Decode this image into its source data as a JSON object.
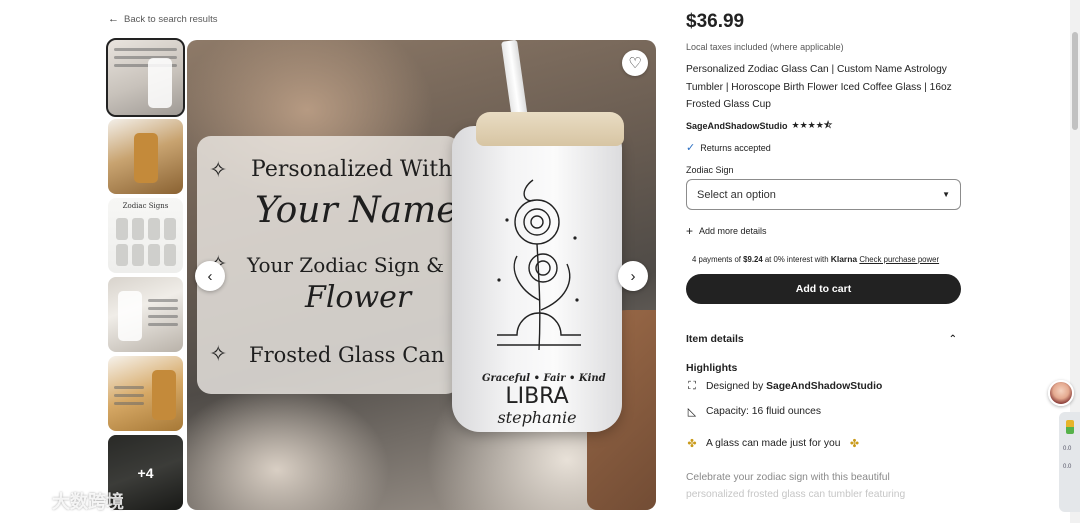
{
  "nav": {
    "back_label": "Back to search results"
  },
  "gallery": {
    "more_count": "+4",
    "thumb3_title": "Zodiac Signs",
    "overlay": {
      "line1": "Personalized With",
      "line2": "Your Name",
      "line3": "Your Zodiac Sign &",
      "line4": "Flower",
      "line5": "Frosted Glass Can"
    },
    "cup": {
      "tagline": "Graceful • Fair • Kind",
      "sign": "LIBRA",
      "name": "stephanie"
    },
    "icons": {
      "favorite": "heart-icon",
      "prev": "chevron-left-icon",
      "next": "chevron-right-icon"
    }
  },
  "product": {
    "price": "$36.99",
    "tax_note": "Local taxes included (where applicable)",
    "title": "Personalized Zodiac Glass Can | Custom Name Astrology Tumbler | Horoscope Birth Flower Iced Coffee Glass | 16oz Frosted Glass Cup",
    "shop_name": "SageAndShadowStudio",
    "rating_stars": "★★★★⯪",
    "returns": "Returns accepted",
    "option_label": "Zodiac Sign",
    "option_placeholder": "Select an option",
    "add_details": "Add more details",
    "klarna": {
      "prefix": "4 payments of ",
      "amount": "$9.24",
      "middle": " at 0% interest with ",
      "brand": "Klarna",
      "link": "Check purchase power"
    },
    "add_to_cart": "Add to cart"
  },
  "details": {
    "section_title": "Item details",
    "highlights_title": "Highlights",
    "designed_by_prefix": "Designed by ",
    "designed_by_shop": "SageAndShadowStudio",
    "capacity": "Capacity: 16 fluid ounces",
    "tagline": "A glass can made just for you",
    "desc_line1": "Celebrate your zodiac sign with this beautiful",
    "desc_line2": "personalized frosted glass can tumbler featuring"
  },
  "overlay_widget": {
    "watermark": "大数跨境",
    "stat1": "0.0",
    "stat2": "0.0"
  }
}
